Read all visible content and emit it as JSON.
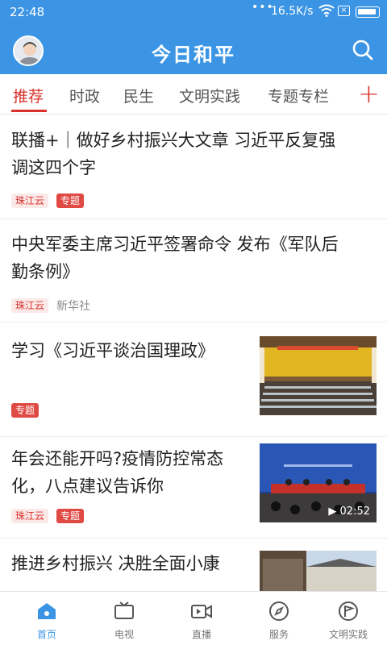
{
  "status": {
    "time": "22:48",
    "speed": "16.5K/s",
    "dots": "•••"
  },
  "header": {
    "title": "今日和平"
  },
  "tabs": [
    {
      "label": "推荐",
      "active": true
    },
    {
      "label": "时政"
    },
    {
      "label": "民生"
    },
    {
      "label": "文明实践"
    },
    {
      "label": "专题专栏"
    }
  ],
  "tab_add_label": "+",
  "feed": [
    {
      "title_line1": "联播+｜做好乡村振兴大文章 习近平反复强",
      "title_line2": "调这四个字",
      "source_tag": "珠江云",
      "special_tag": "专题"
    },
    {
      "title_line1": "中央军委主席习近平签署命令 发布《军队后",
      "title_line2": "勤条例》",
      "source_tag": "珠江云",
      "source": "新华社"
    },
    {
      "title": "学习《习近平谈治国理政》",
      "special_tag": "专题"
    },
    {
      "title_line1": "年会还能开吗?疫情防控常态",
      "title_line2": "化，八点建议告诉你",
      "source_tag": "珠江云",
      "special_tag": "专题",
      "video_duration": "02:52"
    },
    {
      "title": "推进乡村振兴  决胜全面小康"
    }
  ],
  "bottom_nav": [
    {
      "label": "首页",
      "icon": "home-icon",
      "active": true
    },
    {
      "label": "电视",
      "icon": "tv-icon"
    },
    {
      "label": "直播",
      "icon": "live-video-icon"
    },
    {
      "label": "服务",
      "icon": "compass-icon"
    },
    {
      "label": "文明实践",
      "icon": "flag-icon"
    }
  ],
  "colors": {
    "brand_blue": "#3b95e4",
    "accent_red": "#d9302a"
  }
}
